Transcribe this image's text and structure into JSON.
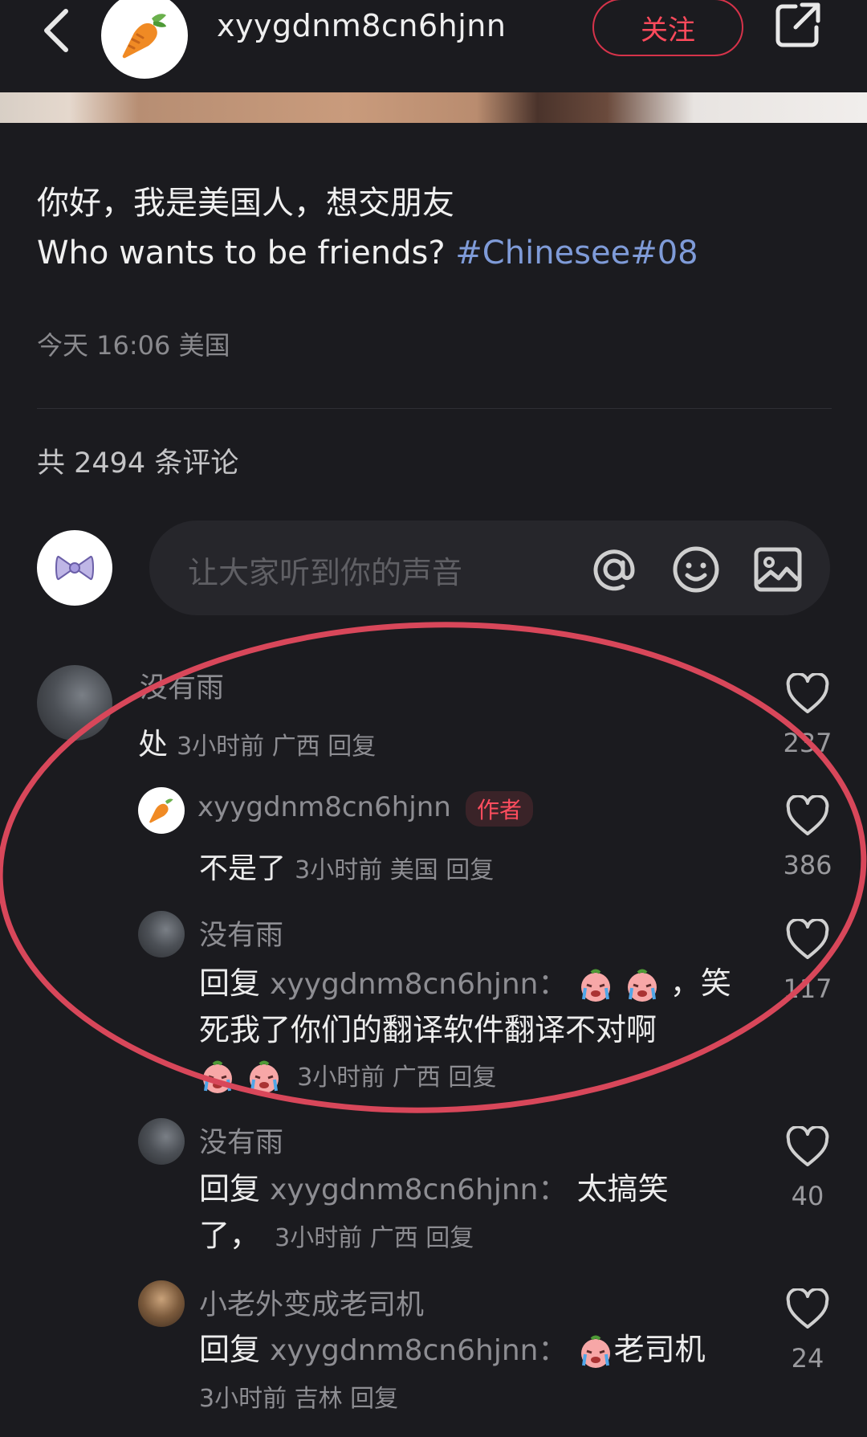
{
  "header": {
    "username": "xyygdnm8cn6hjnn",
    "follow_label": "关注"
  },
  "post": {
    "line1": "你好，我是美国人，想交朋友",
    "line2_text": "Who wants to be friends? ",
    "hashtags": "#Chinesee#08",
    "meta": "今天 16:06 美国"
  },
  "comments_header": {
    "count_label": "共 2494 条评论"
  },
  "input": {
    "placeholder": "让大家听到你的声音"
  },
  "comments": [
    {
      "name": "没有雨",
      "text": "处",
      "meta": "3小时前  广西  回复",
      "likes": "237"
    },
    {
      "name": "xyygdnm8cn6hjnn",
      "tag": "作者",
      "text": "不是了",
      "meta": "3小时前  美国  回复",
      "likes": "386"
    },
    {
      "name": "没有雨",
      "reply_prefix": "回复",
      "reply_to": "xyygdnm8cn6hjnn：",
      "text_after_emoji": "，笑",
      "text_line2": "死我了你们的翻译软件翻译不对啊",
      "meta": "3小时前  广西  回复",
      "likes": "117"
    },
    {
      "name": "没有雨",
      "reply_prefix": "回复",
      "reply_to": "xyygdnm8cn6hjnn：",
      "text": "太搞笑",
      "text_line2": "了，",
      "meta": "3小时前  广西  回复",
      "likes": "40"
    },
    {
      "name": "小老外变成老司机",
      "reply_prefix": "回复",
      "reply_to": "xyygdnm8cn6hjnn：",
      "text": "老司机",
      "meta": "3小时前  吉林  回复",
      "likes": "24"
    }
  ],
  "colors": {
    "background": "#1b1b1f",
    "accent_red": "#ff4a5c",
    "hashtag_blue": "#7f9bd8",
    "annotation_oval": "#d8475a"
  },
  "icons": [
    "back-icon",
    "carrot-icon",
    "share-icon",
    "bow-icon",
    "at-icon",
    "emoji-icon",
    "image-icon",
    "heart-icon",
    "crying-emoji-icon"
  ]
}
